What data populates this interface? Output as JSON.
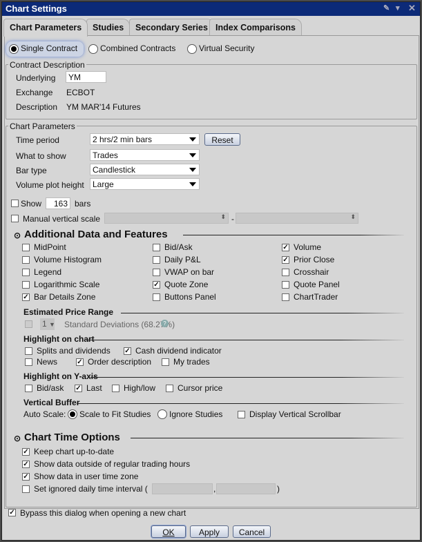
{
  "window": {
    "title": "Chart Settings"
  },
  "tabs": [
    "Chart Parameters",
    "Studies",
    "Secondary Series",
    "Index Comparisons"
  ],
  "contract_type": {
    "options": [
      "Single Contract",
      "Combined Contracts",
      "Virtual Security"
    ],
    "selected": "Single Contract"
  },
  "contract_description": {
    "title": "Contract Description",
    "underlying_label": "Underlying",
    "underlying_value": "YM",
    "exchange_label": "Exchange",
    "exchange_value": "ECBOT",
    "description_label": "Description",
    "description_value": "YM MAR'14 Futures"
  },
  "chart_parameters": {
    "title": "Chart Parameters",
    "time_period_label": "Time period",
    "time_period": "2 hrs/2 min bars",
    "reset": "Reset",
    "what_to_show_label": "What to show",
    "what_to_show": "Trades",
    "bar_type_label": "Bar type",
    "bar_type": "Candlestick",
    "volume_height_label": "Volume plot height",
    "volume_height": "Large",
    "show_label": "Show",
    "show_count": "163",
    "bars_label": "bars",
    "manual_scale_label": "Manual vertical scale",
    "dash": "-"
  },
  "additional": {
    "title": "Additional Data and Features",
    "items": [
      {
        "label": "MidPoint",
        "checked": false
      },
      {
        "label": "Bid/Ask",
        "checked": false
      },
      {
        "label": "Volume",
        "checked": true
      },
      {
        "label": "Volume Histogram",
        "checked": false
      },
      {
        "label": "Daily P&L",
        "checked": false
      },
      {
        "label": "Prior Close",
        "checked": true
      },
      {
        "label": "Legend",
        "checked": false
      },
      {
        "label": "VWAP on bar",
        "checked": false
      },
      {
        "label": "Crosshair",
        "checked": false
      },
      {
        "label": "Logarithmic Scale",
        "checked": false
      },
      {
        "label": "Quote Zone",
        "checked": true
      },
      {
        "label": "Quote Panel",
        "checked": false
      },
      {
        "label": "Bar Details Zone",
        "checked": true
      },
      {
        "label": "Buttons Panel",
        "checked": false
      },
      {
        "label": "ChartTrader",
        "checked": false
      }
    ]
  },
  "price_range": {
    "title": "Estimated Price Range",
    "value": "1",
    "label": "Standard Deviations (68.27%)"
  },
  "highlight_chart": {
    "title": "Highlight on chart",
    "items": [
      {
        "label": "Splits and dividends",
        "checked": false
      },
      {
        "label": "Cash dividend indicator",
        "checked": true
      },
      {
        "label": "News",
        "checked": false
      },
      {
        "label": "Order description",
        "checked": true
      },
      {
        "label": "My trades",
        "checked": false
      }
    ]
  },
  "highlight_y": {
    "title": "Highlight on Y-axis",
    "items": [
      {
        "label": "Bid/ask",
        "checked": false
      },
      {
        "label": "Last",
        "checked": true
      },
      {
        "label": "High/low",
        "checked": false
      },
      {
        "label": "Cursor price",
        "checked": false
      }
    ]
  },
  "vertical_buffer": {
    "title": "Vertical Buffer",
    "auto_scale_label": "Auto Scale:",
    "scale_fit": "Scale to Fit Studies",
    "ignore": "Ignore Studies",
    "scrollbar": "Display Vertical Scrollbar"
  },
  "time_options": {
    "title": "Chart Time Options",
    "items": [
      {
        "label": "Keep chart up-to-date",
        "checked": true
      },
      {
        "label": "Show data outside of regular trading hours",
        "checked": true
      },
      {
        "label": "Show data in user time zone",
        "checked": true
      },
      {
        "label": "Set ignored daily time interval (",
        "checked": false
      }
    ],
    "comma": ",",
    "close": ")"
  },
  "footer": {
    "bypass": "Bypass this dialog when opening a new chart",
    "bypass_checked": true,
    "ok": "OK",
    "apply": "Apply",
    "cancel": "Cancel"
  }
}
